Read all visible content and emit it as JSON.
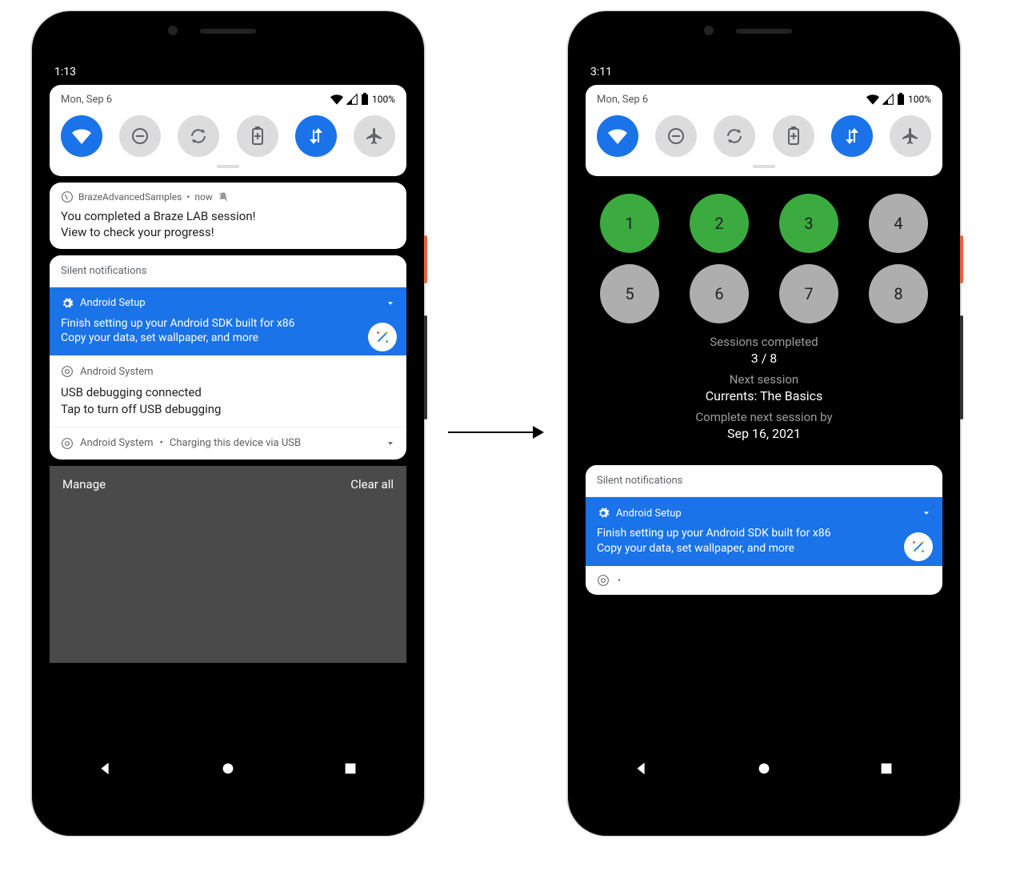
{
  "left": {
    "time": "1:13",
    "date": "Mon, Sep 6",
    "battery": "100%",
    "braze_app": "BrazeAdvancedSamples",
    "braze_when": "now",
    "braze_title": "You completed a Braze LAB session!",
    "braze_body": "View to check your progress!",
    "silent_header": "Silent notifications",
    "setup_app": "Android Setup",
    "setup_title": "Finish setting up your Android SDK built for x86",
    "setup_body": "Copy your data, set wallpaper, and more",
    "sys_app": "Android System",
    "sys_title": "USB debugging connected",
    "sys_body": "Tap to turn off USB debugging",
    "collapsed_app": "Android System",
    "collapsed_text": "Charging this device via USB",
    "manage": "Manage",
    "clear_all": "Clear all"
  },
  "right": {
    "time": "3:11",
    "date": "Mon, Sep 6",
    "battery": "100%",
    "circles": [
      "1",
      "2",
      "3",
      "4",
      "5",
      "6",
      "7",
      "8"
    ],
    "done_count": 3,
    "sessions_label": "Sessions completed",
    "sessions_value": "3 / 8",
    "next_label": "Next session",
    "next_value": "Currents: The Basics",
    "due_label": "Complete next session by",
    "due_value": "Sep 16, 2021",
    "silent_header": "Silent notifications",
    "setup_app": "Android Setup",
    "setup_title": "Finish setting up your Android SDK built for x86",
    "setup_body": "Copy your data, set wallpaper, and more"
  }
}
